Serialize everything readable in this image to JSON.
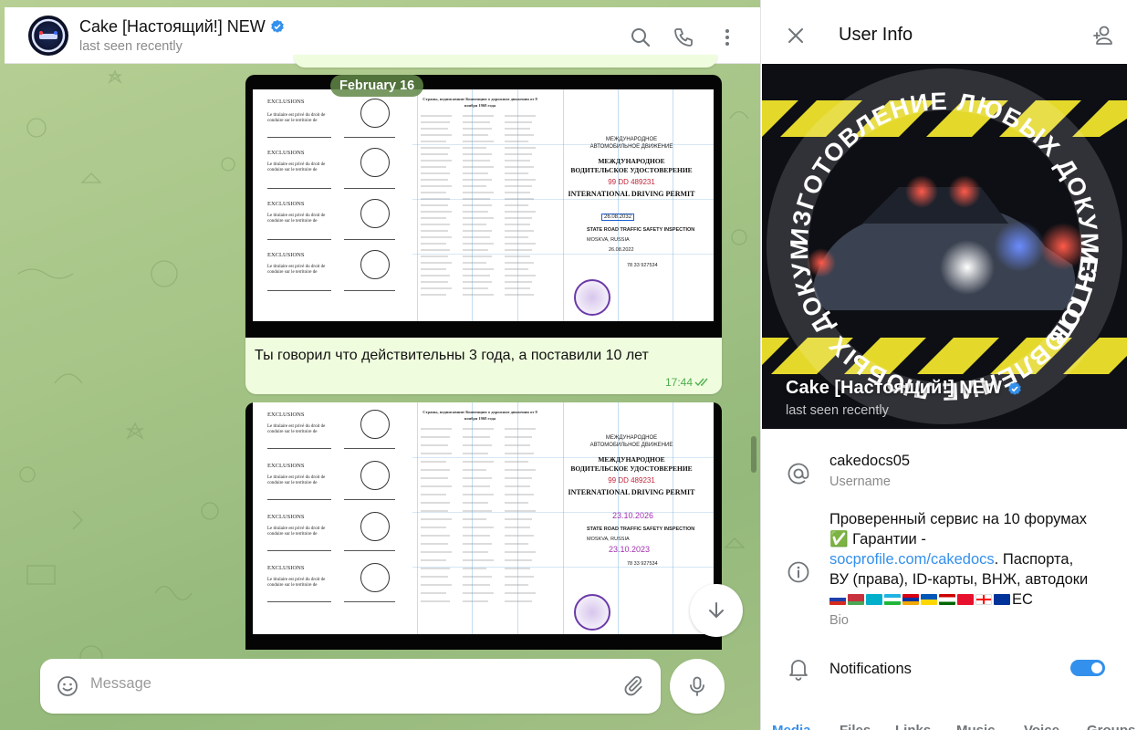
{
  "chat": {
    "title": "Cake [Настоящий!] NEW",
    "status": "last seen recently",
    "date_pill": "February 16",
    "messages": [
      {
        "text": "Ты говорил что действительны 3 года, а поставили 10 лет",
        "time": "17:44"
      }
    ],
    "composer": {
      "placeholder": "Message"
    }
  },
  "document": {
    "exclusions_label": "EXCLUSIONS",
    "exclusion_line": "Le titulaire est privé du droit de conduire sur le territoire de",
    "countries_header": "Страны, подписавшие Конвенцию о дорожном движении от 8 ноября 1968 года",
    "title_ru_1": "МЕЖДУНАРОДНОЕ",
    "title_ru_2": "АВТОМОБИЛЬНОЕ ДВИЖЕНИЕ",
    "title_ru_3": "МЕЖДУНАРОДНОЕ",
    "title_ru_4": "ВОДИТЕЛЬСКОЕ УДОСТОВЕРЕНИЕ",
    "number": "99 DD 489231",
    "title_en": "INTERNATIONAL DRIVING PERMIT",
    "issued_by": "STATE ROAD TRAFFIC SAFETY INSPECTION",
    "place": "MOSKVA, RUSSIA",
    "license_no": "78 33 927534",
    "valid_until_1": "26.08.2032",
    "issue_date_1": "26.08.2022",
    "valid_until_2": "23.10.2026",
    "issue_date_2": "23.10.2023"
  },
  "info": {
    "title": "User Info",
    "name": "Cake [Настоящий!] NEW",
    "status": "last seen recently",
    "cover_ring_text": "ИЗГОТОВЛЕНИЕ ЛЮБЫХ ДОКУМЕНТОВ",
    "username": "cakedocs05",
    "username_label": "Username",
    "bio_line1": "Проверенный сервис на 10 форумах",
    "bio_line2": "✅ Гарантии -",
    "bio_link": "socprofile.com/cakedocs",
    "bio_line3": ". Паспорта,",
    "bio_line4": "ВУ (права), ID-карты, ВНЖ, автодоки",
    "bio_flags_suffix": "ЕС",
    "bio_label": "Bio",
    "notifications_label": "Notifications",
    "notifications_on": true,
    "tabs": [
      "Media",
      "Files",
      "Links",
      "Music",
      "Voice",
      "Groups"
    ]
  },
  "colors": {
    "accent": "#3390ec",
    "bubble": "#effdde",
    "time_green": "#4fae4e"
  },
  "icons": [
    "search-icon",
    "phone-icon",
    "more-vertical-icon",
    "close-icon",
    "add-contact-icon",
    "at-icon",
    "info-icon",
    "bell-icon",
    "emoji-icon",
    "attach-icon",
    "mic-icon",
    "arrow-down-icon",
    "verified-icon"
  ]
}
